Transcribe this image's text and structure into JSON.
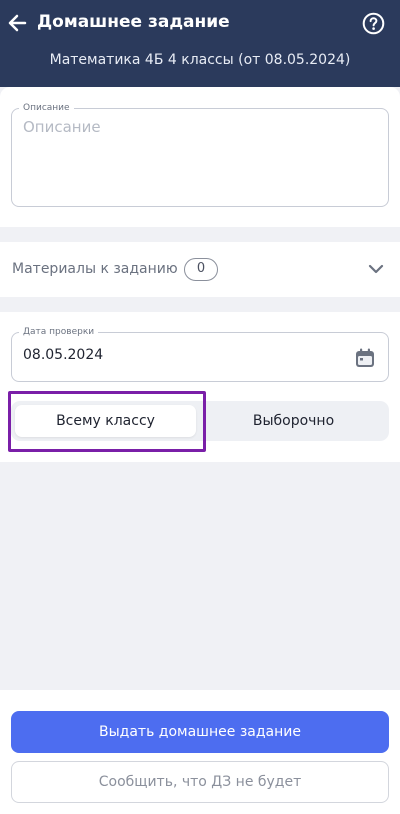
{
  "header": {
    "title": "Домашнее задание",
    "subtitle": "Математика 4Б 4 классы (от 08.05.2024)",
    "back_icon": "arrow-left-icon",
    "help_icon": "question-circle-icon"
  },
  "description": {
    "legend": "Описание",
    "placeholder": "Описание"
  },
  "materials": {
    "label": "Материалы к заданию",
    "count": "0",
    "expand_icon": "chevron-down-icon"
  },
  "check_date": {
    "legend": "Дата проверки",
    "value": "08.05.2024",
    "calendar_icon": "calendar-icon"
  },
  "assign_mode": {
    "options": [
      "Всему классу",
      "Выборочно"
    ],
    "selected": "Всему классу"
  },
  "actions": {
    "primary": "Выдать домашнее задание",
    "secondary": "Сообщить, что ДЗ не будет"
  },
  "colors": {
    "header_bg": "#2b3a5c",
    "primary": "#4d6df0",
    "highlight": "#7a1fa8"
  }
}
